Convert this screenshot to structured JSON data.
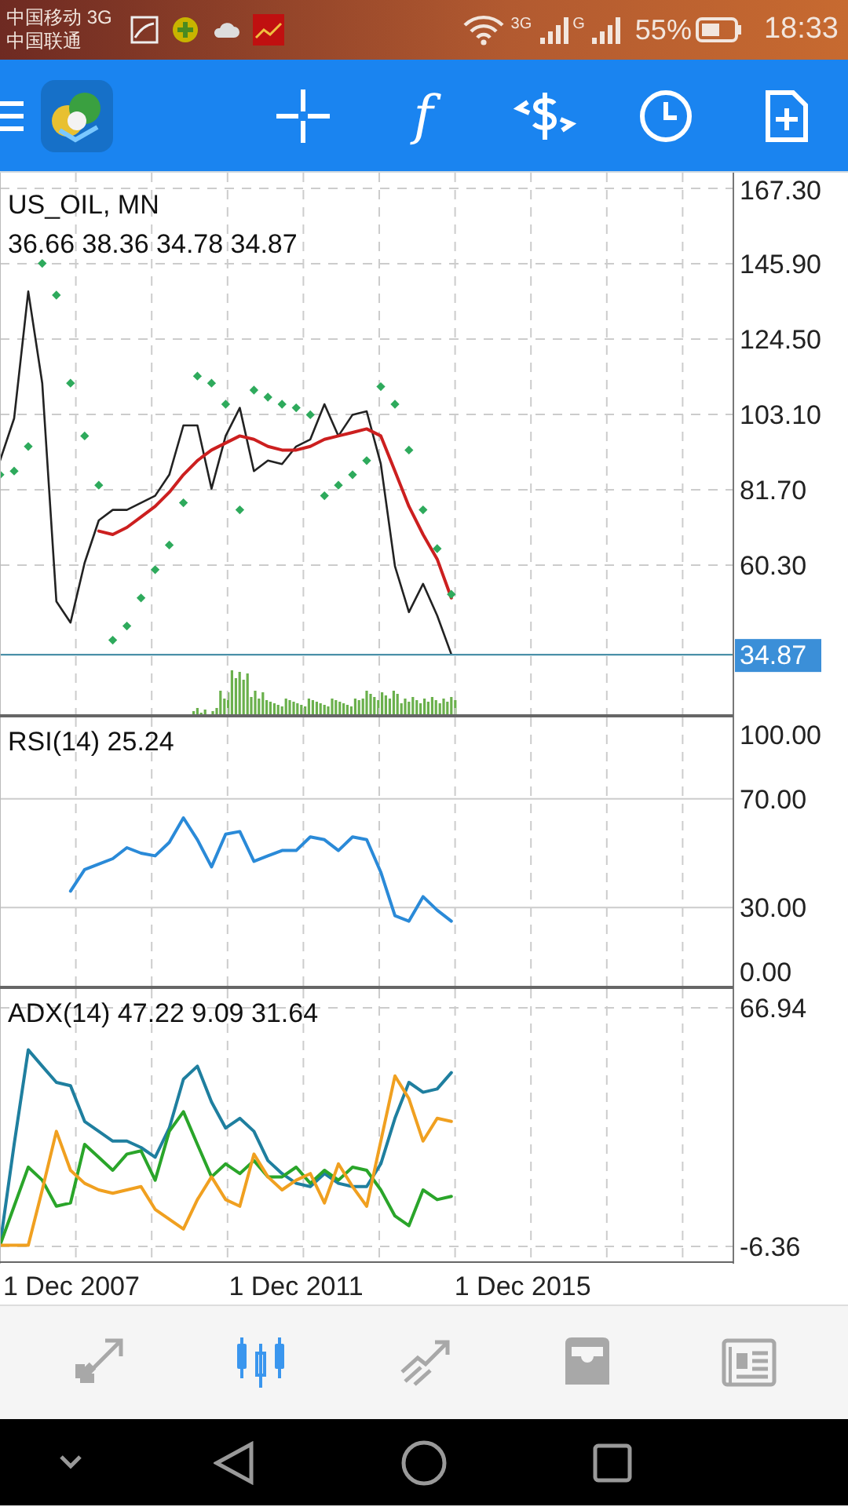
{
  "status_bar": {
    "carrier_1": "中国移动 3G",
    "carrier_2": "中国联通",
    "network_1": "3G",
    "network_2": "G",
    "battery": "55%",
    "time": "18:33"
  },
  "toolbar": {
    "function_button": "f"
  },
  "panes": [
    {
      "title": "US_OIL, MN",
      "values": "36.66 38.36 34.78 34.87",
      "chart_data": {
        "type": "line",
        "grid": true,
        "ylim": [
          17.07,
          171.76
        ],
        "categories": [
          null,
          null,
          null,
          null,
          null,
          null,
          null,
          null,
          null,
          null,
          null,
          null,
          null,
          null,
          null,
          null,
          null,
          null,
          null,
          null,
          null,
          null,
          null,
          null,
          null,
          null,
          null,
          null,
          null,
          null,
          null,
          null,
          null,
          null,
          null,
          null,
          null,
          null,
          null,
          null,
          null,
          null,
          null,
          null,
          null,
          null,
          null,
          null,
          null,
          null,
          null,
          null
        ],
        "yticks": [
          {
            "value": 167.3,
            "label": "167.30"
          },
          {
            "value": 145.9,
            "label": "145.90"
          },
          {
            "value": 124.5,
            "label": "124.50"
          },
          {
            "value": 103.1,
            "label": "103.10"
          },
          {
            "value": 81.7,
            "label": "81.70"
          },
          {
            "value": 60.3,
            "label": "60.30"
          }
        ],
        "ref_lines": [
          {
            "axis": "y",
            "value": 34.87,
            "label": "34.87"
          }
        ],
        "series": [
          {
            "type": "line",
            "color": "#222222",
            "values": [
              90,
              102,
              138,
              112,
              50,
              44,
              61,
              73,
              76,
              76,
              78,
              80,
              86,
              100,
              100,
              82,
              97,
              105,
              87,
              90,
              89,
              94,
              96,
              106,
              97,
              103,
              104,
              89,
              60,
              47,
              55,
              46,
              35,
              null,
              null,
              null,
              null,
              null,
              null,
              null,
              null,
              null,
              null,
              null,
              null,
              null,
              null,
              null,
              null,
              null,
              null,
              null
            ]
          },
          {
            "type": "line",
            "color": "#cc1f1f",
            "values": [
              null,
              null,
              null,
              null,
              null,
              null,
              null,
              70,
              69,
              71,
              74,
              77,
              81,
              86,
              90,
              93,
              95,
              97,
              96,
              94,
              93,
              93,
              94,
              96,
              97,
              98,
              99,
              97,
              87,
              77,
              69,
              62,
              51,
              null,
              null,
              null,
              null,
              null,
              null,
              null,
              null,
              null,
              null,
              null,
              null,
              null,
              null,
              null,
              null,
              null,
              null,
              null
            ]
          },
          {
            "type": "scatter",
            "color": "#2eaa5c",
            "values": [
              86,
              87,
              94,
              146,
              137,
              112,
              97,
              83,
              39,
              43,
              51,
              59,
              66,
              78,
              114,
              112,
              106,
              76,
              110,
              108,
              106,
              105,
              103,
              80,
              83,
              86,
              90,
              111,
              106,
              93,
              76,
              65,
              52,
              null,
              null,
              null,
              null,
              null,
              null,
              null,
              null,
              null,
              null,
              null,
              null,
              null,
              null,
              null,
              null,
              null,
              null,
              null
            ]
          }
        ]
      }
    },
    {
      "title": "RSI(14) 25.24",
      "chart_data": {
        "type": "line",
        "grid": true,
        "ylim": [
          0,
          100
        ],
        "categories": [
          null,
          null,
          null,
          null,
          null,
          null,
          null,
          null,
          null,
          null,
          null,
          null,
          null,
          null,
          null,
          null,
          null,
          null,
          null,
          null,
          null,
          null,
          null,
          null,
          null,
          null,
          null,
          null,
          null,
          null,
          null,
          null,
          null,
          null,
          null,
          null,
          null,
          null,
          null,
          null,
          null,
          null,
          null,
          null,
          null,
          null,
          null,
          null,
          null,
          null,
          null,
          null
        ],
        "yticks": [
          {
            "value": 100,
            "label": "100.00"
          },
          {
            "value": 70,
            "label": "70.00"
          },
          {
            "value": 30,
            "label": "30.00"
          },
          {
            "value": 0,
            "label": "0.00"
          }
        ],
        "series": [
          {
            "type": "line",
            "color": "#2a8ad8",
            "values": [
              null,
              null,
              null,
              null,
              null,
              36,
              44,
              46,
              48,
              52,
              50,
              49,
              54,
              63,
              55,
              45,
              57,
              58,
              47,
              49,
              51,
              51,
              56,
              55,
              51,
              56,
              55,
              43,
              27,
              25,
              34,
              29,
              25,
              null,
              null,
              null,
              null,
              null,
              null,
              null,
              null,
              null,
              null,
              null,
              null,
              null,
              null,
              null,
              null,
              null,
              null,
              null
            ]
          }
        ]
      }
    },
    {
      "title": "ADX(14) 47.22 9.09 31.64",
      "date_labels": [
        "1 Dec 2007",
        "1 Dec 2011",
        "1 Dec 2015"
      ],
      "chart_data": {
        "type": "line",
        "grid": true,
        "ylim": [
          -11.66,
          72.7
        ],
        "categories": [
          null,
          null,
          null,
          null,
          null,
          null,
          null,
          null,
          null,
          null,
          null,
          null,
          null,
          null,
          null,
          null,
          null,
          null,
          null,
          null,
          null,
          null,
          null,
          null,
          null,
          null,
          null,
          null,
          null,
          null,
          null,
          null,
          null,
          null,
          null,
          null,
          null,
          null,
          null,
          null,
          null,
          null,
          null,
          null,
          null,
          null,
          null,
          null,
          null,
          null,
          null,
          null
        ],
        "yticks": [
          {
            "value": 66.94,
            "label": "66.94"
          },
          {
            "value": -6.36,
            "label": "-6.36"
          }
        ],
        "series": [
          {
            "type": "line",
            "color": "#1f7f9f",
            "values": [
              -6,
              25,
              54,
              49,
              44,
              43,
              32,
              29,
              26,
              26,
              24,
              21,
              30,
              45,
              49,
              38,
              30,
              33,
              29,
              20,
              16,
              13,
              12,
              16,
              13,
              12,
              12,
              19,
              33,
              44,
              41,
              42,
              47,
              null,
              null,
              null,
              null,
              null,
              null,
              null,
              null,
              null,
              null,
              null,
              null,
              null,
              null,
              null,
              null,
              null,
              null,
              null
            ]
          },
          {
            "type": "line",
            "color": "#2aa52a",
            "values": [
              -6,
              6,
              18,
              14,
              6,
              7,
              25,
              21,
              17,
              22,
              23,
              14,
              29,
              35,
              25,
              15,
              19,
              16,
              20,
              15,
              15,
              18,
              13,
              17,
              14,
              18,
              17,
              11,
              3,
              0,
              11,
              8,
              9,
              null,
              null,
              null,
              null,
              null,
              null,
              null,
              null,
              null,
              null,
              null,
              null,
              null,
              null,
              null,
              null,
              null,
              null,
              null
            ]
          },
          {
            "type": "line",
            "color": "#f0a020",
            "values": [
              -6,
              -6,
              -6,
              11,
              29,
              17,
              13,
              11,
              10,
              11,
              12,
              5,
              2,
              -1,
              8,
              15,
              8,
              6,
              22,
              15,
              11,
              14,
              16,
              7,
              19,
              12,
              6,
              26,
              46,
              39,
              26,
              33,
              32,
              null,
              null,
              null,
              null,
              null,
              null,
              null,
              null,
              null,
              null,
              null,
              null,
              null,
              null,
              null,
              null,
              null,
              null,
              null
            ]
          }
        ]
      }
    }
  ],
  "bottom_nav": [
    {
      "selected": false
    },
    {
      "selected": true
    },
    {
      "selected": false
    },
    {
      "selected": false
    },
    {
      "selected": false
    }
  ]
}
